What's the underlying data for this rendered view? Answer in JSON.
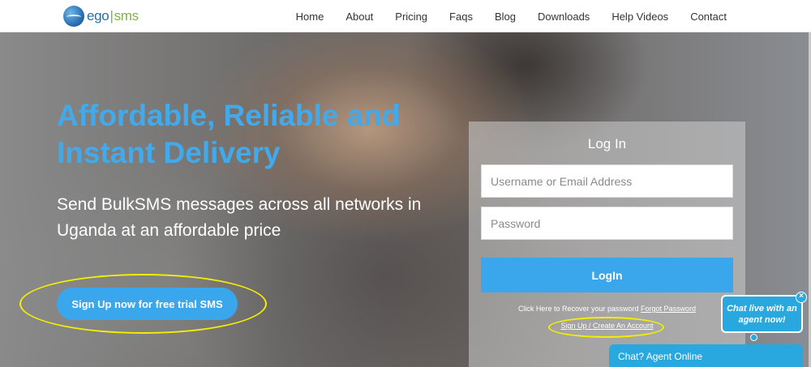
{
  "brand": {
    "logo_main": "ego",
    "logo_sep": "|",
    "logo_accent": "sms",
    "primary_color": "#3aa6ec",
    "highlight_color": "#f3ef00"
  },
  "nav": {
    "items": [
      "Home",
      "About",
      "Pricing",
      "Faqs",
      "Blog",
      "Downloads",
      "Help Videos",
      "Contact"
    ]
  },
  "hero": {
    "headline_line1": "Affordable, Reliable and",
    "headline_line2": "Instant Delivery",
    "subline_line1": "Send BulkSMS messages across all networks in",
    "subline_line2": "Uganda at an affordable price",
    "cta_label": "Sign Up now for free trial SMS"
  },
  "login": {
    "title": "Log In",
    "username_placeholder": "Username or Email Address",
    "password_placeholder": "Password",
    "submit_label": "LogIn",
    "recover_text": "Click Here to Recover your password",
    "recover_link": "Forgot Password",
    "signup_link": "Sign Up / Create An Account"
  },
  "chat": {
    "bubble_line1": "Chat live with an",
    "bubble_line2": "agent now!",
    "close_symbol": "×",
    "bar_label": "Chat? Agent Online"
  }
}
